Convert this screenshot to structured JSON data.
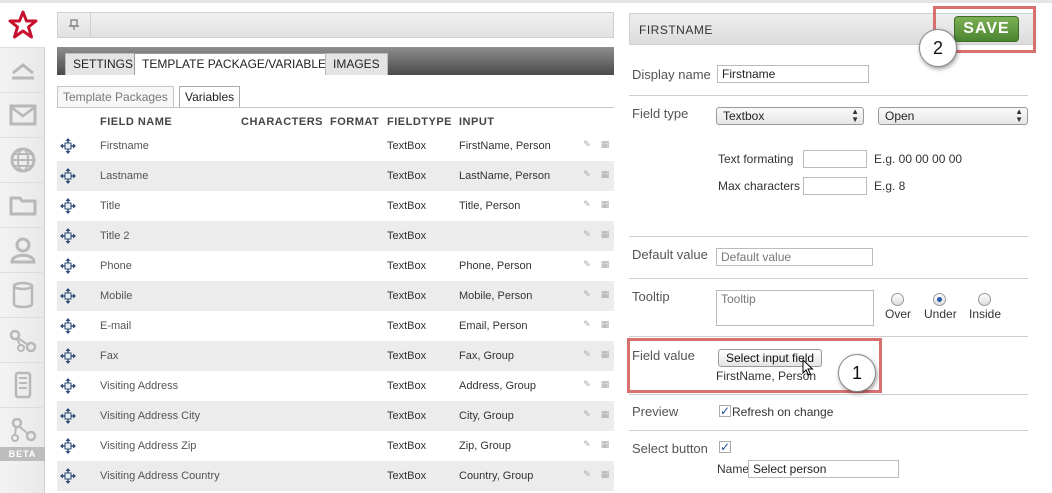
{
  "toolbar": {
    "pin_icon": "pin-icon"
  },
  "rail": {
    "items": [
      "star-icon",
      "arrows-icon",
      "mail-icon",
      "globe-icon",
      "folder-icon",
      "user-icon",
      "database-icon",
      "share-icon",
      "mobile-icon",
      "share-beta-icon"
    ],
    "beta": "BETA",
    "accent": "#c8102e"
  },
  "tabs": [
    "SETTINGS",
    "TEMPLATE PACKAGE/VARIABLES",
    "IMAGES"
  ],
  "subtabs": [
    "Template Packages",
    "Variables"
  ],
  "table": {
    "headers": [
      "FIELD NAME",
      "CHARACTERS",
      "FORMAT",
      "FIELDTYPE",
      "INPUT"
    ],
    "rows": [
      {
        "name": "Firstname",
        "type": "TextBox",
        "input": "FirstName, Person"
      },
      {
        "name": "Lastname",
        "type": "TextBox",
        "input": "LastName, Person"
      },
      {
        "name": "Title",
        "type": "TextBox",
        "input": "Title, Person"
      },
      {
        "name": "Title 2",
        "type": "TextBox",
        "input": ""
      },
      {
        "name": "Phone",
        "type": "TextBox",
        "input": "Phone, Person"
      },
      {
        "name": "Mobile",
        "type": "TextBox",
        "input": "Mobile, Person"
      },
      {
        "name": "E-mail",
        "type": "TextBox",
        "input": "Email, Person"
      },
      {
        "name": "Fax",
        "type": "TextBox",
        "input": "Fax, Group"
      },
      {
        "name": "Visiting Address",
        "type": "TextBox",
        "input": "Address, Group"
      },
      {
        "name": "Visiting Address City",
        "type": "TextBox",
        "input": "City, Group"
      },
      {
        "name": "Visiting Address Zip",
        "type": "TextBox",
        "input": "Zip, Group"
      },
      {
        "name": "Visiting Address Country",
        "type": "TextBox",
        "input": "Country, Group"
      }
    ]
  },
  "panel": {
    "title": "FIRSTNAME",
    "save_label": "SAVE",
    "save_color": "#5a9a3c",
    "badge_save": "2",
    "badge_field": "1",
    "display_name_label": "Display name",
    "display_name_value": "Firstname",
    "field_type_label": "Field type",
    "field_type_value": "Textbox",
    "field_mode_value": "Open",
    "text_formatting_label": "Text formating",
    "text_formatting_hint": "E.g. 00 00 00 00",
    "max_chars_label": "Max characters",
    "max_chars_hint": "E.g. 8",
    "default_value_label": "Default value",
    "default_value_placeholder": "Default value",
    "tooltip_label": "Tooltip",
    "tooltip_placeholder": "Tooltip",
    "tooltip_positions": [
      "Over",
      "Under",
      "Inside"
    ],
    "tooltip_selected": "Under",
    "field_value_label": "Field value",
    "select_input_button": "Select input field",
    "field_value_text": "FirstName, Person",
    "preview_label": "Preview",
    "refresh_label": "Refresh on change",
    "select_button_label": "Select button",
    "name_label": "Name",
    "name_value": "Select  person"
  }
}
